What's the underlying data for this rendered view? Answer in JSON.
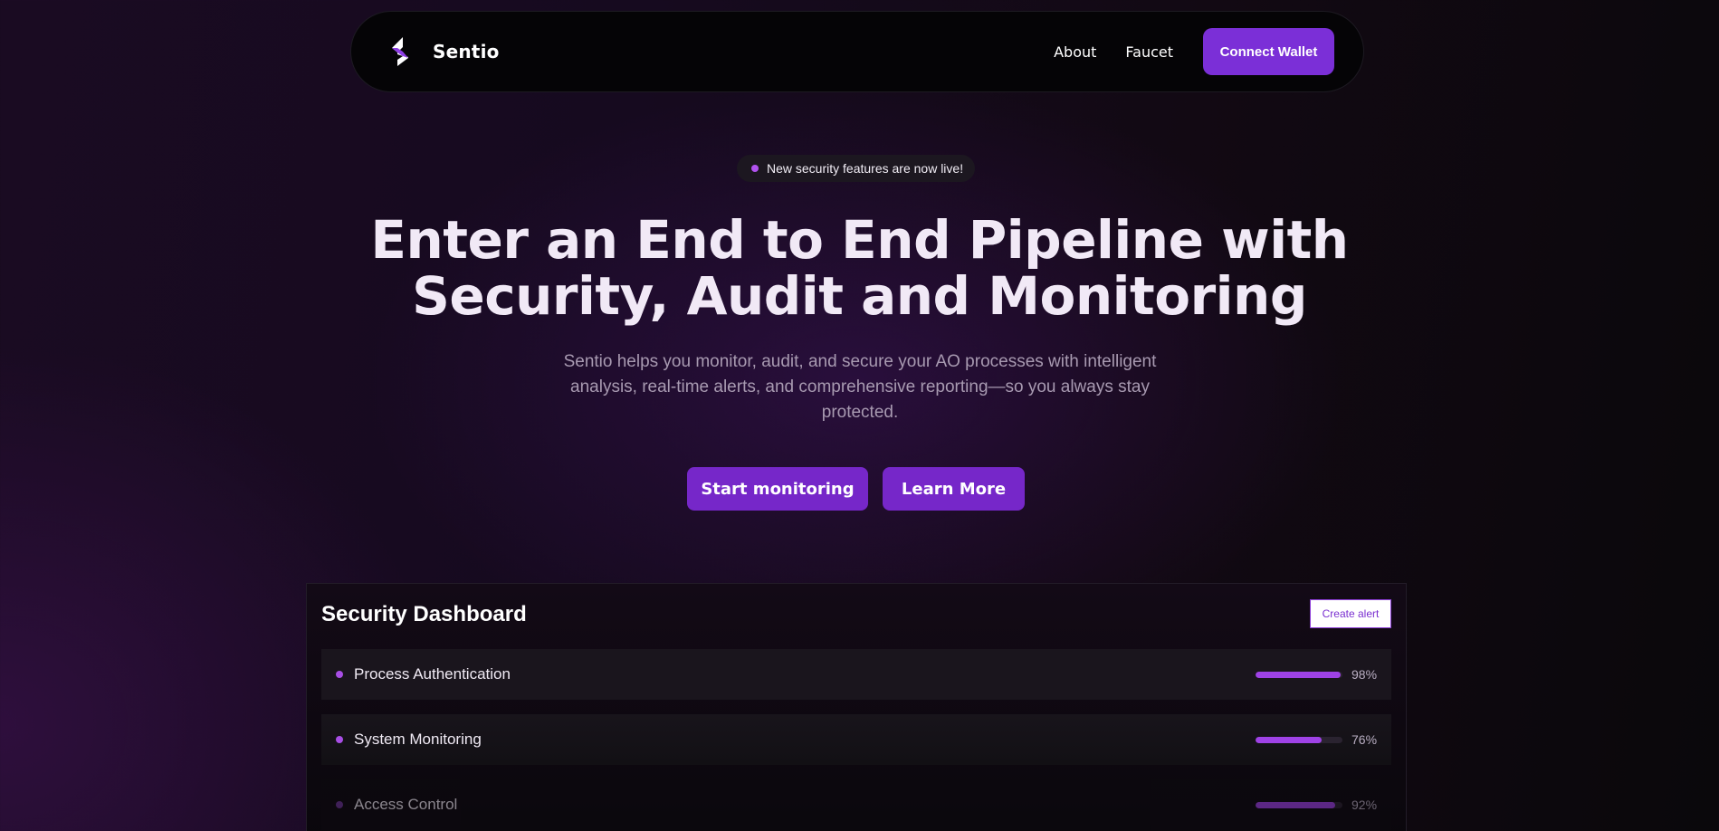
{
  "nav": {
    "brand": "Sentio",
    "links": [
      "About",
      "Faucet"
    ],
    "connect_label": "Connect Wallet"
  },
  "announcement": "New security features are now live!",
  "hero": {
    "title_line1": "Enter an End to End Pipeline with",
    "title_line2": "Security, Audit and Monitoring",
    "subtitle": "Sentio helps you monitor, audit, and secure your AO processes with intelligent analysis, real-time alerts, and comprehensive reporting—so you always stay protected.",
    "primary_cta": "Start monitoring",
    "secondary_cta": "Learn More"
  },
  "dashboard": {
    "title": "Security Dashboard",
    "create_alert_label": "Create alert",
    "metrics": [
      {
        "label": "Process Authentication",
        "percent_label": "98%",
        "value": 98
      },
      {
        "label": "System Monitoring",
        "percent_label": "76%",
        "value": 76
      },
      {
        "label": "Access Control",
        "percent_label": "92%",
        "value": 92
      }
    ]
  },
  "colors": {
    "accent": "#7b2fd7",
    "dot": "#b152f0",
    "background": "#140a1a"
  }
}
